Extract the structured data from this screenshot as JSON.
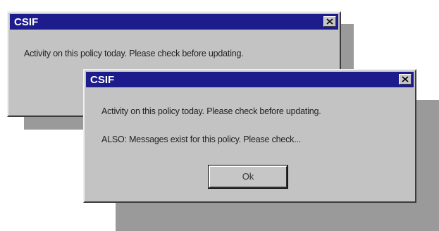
{
  "back_dialog": {
    "title": "CSIF",
    "message": "Activity on this policy today.  Please check before updating."
  },
  "front_dialog": {
    "title": "CSIF",
    "message1": "Activity on this policy today.  Please check before updating.",
    "message2": "ALSO:  Messages exist for this policy.  Please check...",
    "ok_label": "Ok"
  }
}
